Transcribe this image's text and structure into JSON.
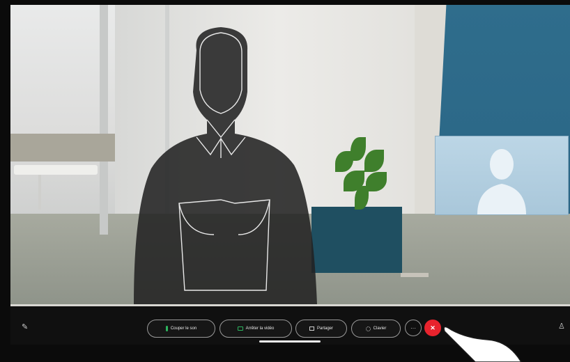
{
  "call_controls": {
    "mute_label": "Couper le son",
    "stop_video_label": "Arrêter la vidéo",
    "share_label": "Partager",
    "keypad_label": "Clavier",
    "more_label": "···",
    "end_call_label": "✕"
  },
  "icons": {
    "edit": "pencil-icon",
    "participants": "participants-icon"
  },
  "colors": {
    "end_call": "#e8232d",
    "active_green": "#2db45e"
  }
}
